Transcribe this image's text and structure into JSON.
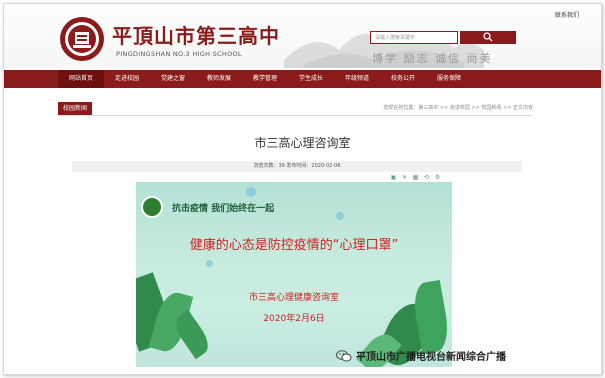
{
  "header": {
    "contact_link": "联系我们",
    "school_name": "平頂山市第三高中",
    "school_name_en": "PINGDINGSHAN NO.3 HIGH SCHOOL",
    "search": {
      "placeholder": "请输入搜索关键字",
      "button_icon": "search-icon"
    },
    "motto": "博学 励志 诚信 尚美"
  },
  "nav": {
    "items": [
      {
        "label": "网站首页"
      },
      {
        "label": "走进校园"
      },
      {
        "label": "党建之窗"
      },
      {
        "label": "教师发展"
      },
      {
        "label": "教学管理"
      },
      {
        "label": "学生成长"
      },
      {
        "label": "年级频道"
      },
      {
        "label": "校务公开"
      },
      {
        "label": "服务保障"
      }
    ]
  },
  "section": {
    "tab": "校园新闻",
    "breadcrumb": "您现在的位置：第三高中 >> 走进校园 >> 校园新闻 >> 正文内容"
  },
  "article": {
    "title": "市三高心理咨询室",
    "meta": "浏览次数：39    发布时间：2020-02-06"
  },
  "poster": {
    "slogan": "抗击疫情  我们始终在一起",
    "headline": "健康的心态是防控疫情的“心理口罩”",
    "org": "市三高心理健康咨询室",
    "date": "2020年2月6日"
  },
  "watermark": {
    "text": "平顶山市广播电视台新闻综合广播",
    "icon": "wechat-icon"
  },
  "colors": {
    "brand": "#8b1a1a",
    "headline_red": "#d42020",
    "poster_bg": "#c8ecde"
  }
}
